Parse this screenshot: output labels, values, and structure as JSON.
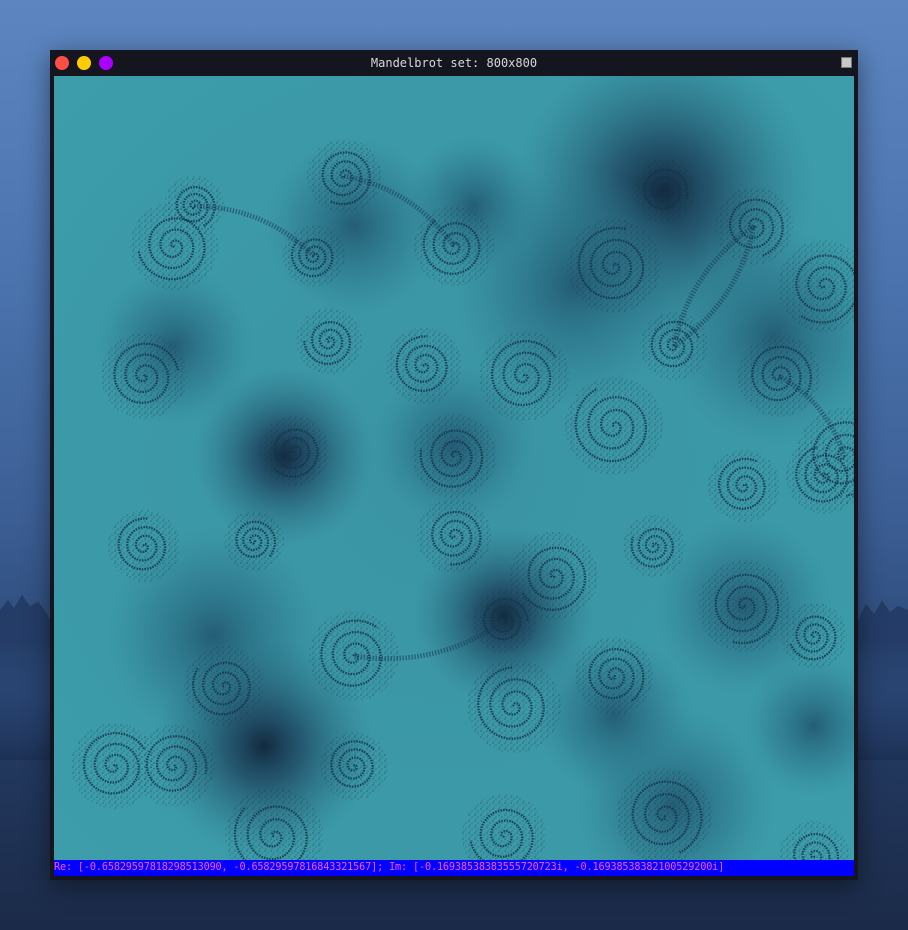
{
  "window": {
    "title": "Mandelbrot set: 800x800",
    "colors": {
      "close": "#ff4f44",
      "minimize": "#ffcc00",
      "maximize": "#aa00ff",
      "titlebar": "#15151f"
    }
  },
  "canvas": {
    "palette": {
      "background": "#3c9aa8",
      "mid": "#2f7f92",
      "dark": "#1c3f5c",
      "darkest": "#0f2236"
    }
  },
  "statusbar": {
    "text": "Re: [-0.65829597818298513090, -0.65829597816843321567]; Im: [-0.16938538383555720723i, -0.16938538382100529200i]",
    "background": "#0000ff",
    "color": "#ff55ff"
  }
}
